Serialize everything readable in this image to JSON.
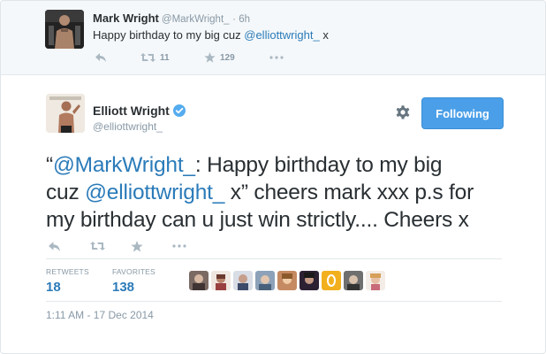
{
  "parent_tweet": {
    "name": "Mark Wright",
    "handle": "@MarkWright_",
    "time": "· 6h",
    "text_prefix": "Happy birthday to my big cuz ",
    "mention": "@elliottwright_",
    "text_suffix": " x",
    "retweets": "11",
    "favorites": "129",
    "icons": [
      "reply-icon",
      "retweet-icon",
      "favorite-icon",
      "more-icon"
    ]
  },
  "main_tweet": {
    "name": "Elliott Wright",
    "handle": "@elliottwright_",
    "follow_label": "Following",
    "line1_quote": "“",
    "line1_mention": "@MarkWright_",
    "line1_rest": ": Happy birthday to my big",
    "line2_prefix": "cuz ",
    "line2_mention": "@elliottwright_",
    "line2_rest": " x” cheers mark xxx p.s for",
    "line3": "my birthday can u just win strictly.... Cheers x",
    "retweets_label": "RETWEETS",
    "retweets": "18",
    "favorites_label": "FAVORITES",
    "favorites": "138",
    "timestamp": "1:11 AM - 17 Dec 2014",
    "icons": [
      "reply-icon",
      "retweet-icon",
      "favorite-icon",
      "more-icon",
      "gear-icon",
      "verified-icon"
    ]
  },
  "colors": {
    "link": "#2b7bb9",
    "follow_button": "#4a9fe8",
    "muted": "#8899a6",
    "parent_bg": "#f5f8fa"
  }
}
